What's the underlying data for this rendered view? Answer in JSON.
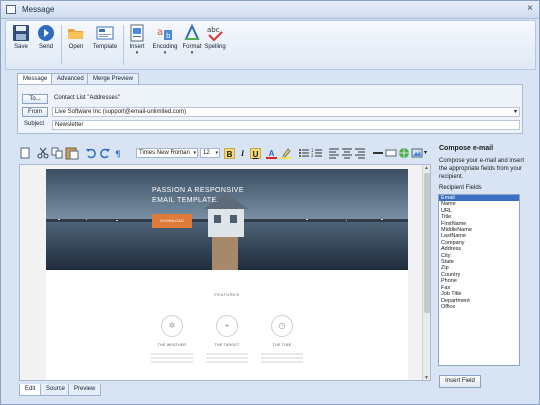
{
  "window": {
    "title": "Message",
    "close": "×"
  },
  "ribbon": {
    "buttons": [
      {
        "label": "Save",
        "icon": "floppy-disk-icon"
      },
      {
        "label": "Send",
        "icon": "send-arrow-icon"
      },
      {
        "label": "Open",
        "icon": "folder-open-icon"
      },
      {
        "label": "Template",
        "icon": "template-icon"
      },
      {
        "label": "Insert",
        "icon": "insert-icon",
        "caret": "▾"
      },
      {
        "label": "Encoding",
        "icon": "encoding-icon",
        "caret": "▾"
      },
      {
        "label": "Format",
        "icon": "format-icon",
        "caret": "▾"
      },
      {
        "label": "Spelling",
        "icon": "spelling-check-icon"
      }
    ]
  },
  "tabs": [
    "Message",
    "Advanced",
    "Merge Preview"
  ],
  "header": {
    "to_button": "To...",
    "to_value": "Contact List \"Addresses\"",
    "from_button": "From",
    "from_value": "Live Software Inc (support@email-unlimited.com)",
    "subject_label": "Subject",
    "subject_value": "Newsletter"
  },
  "toolbar": {
    "font": "Times New Roman",
    "size": "12",
    "bold": "B",
    "italic": "I",
    "underline": "U",
    "font_color": "A"
  },
  "email": {
    "hero_title": "PASSION A RESPONSIVE EMAIL TEMPLATE.",
    "hero_button": "DOWNLOAD",
    "features_title": "FEATURES",
    "features": [
      "THE WEATHER",
      "THE TARGET",
      "THE TIME"
    ]
  },
  "bottom_tabs": [
    "Edit",
    "Source",
    "Preview"
  ],
  "sidebar": {
    "title": "Compose e-mail",
    "description": "Compose your e-mail and insert the appropriate fields from your recipient.",
    "fields_heading": "Recipient Fields",
    "fields": [
      "Email",
      "Name",
      "URL",
      "Title",
      "FirstName",
      "MiddleName",
      "LastName",
      "Company",
      "Address",
      "City",
      "State",
      "Zip",
      "Country",
      "Phone",
      "Fax",
      "Job Title",
      "Department",
      "Office"
    ],
    "selected_field": "Email",
    "insert_button": "Insert Field"
  },
  "colors": {
    "accent": "#3a6fc4",
    "hero_button": "#e07a38",
    "chrome": "#d8e4f3"
  }
}
